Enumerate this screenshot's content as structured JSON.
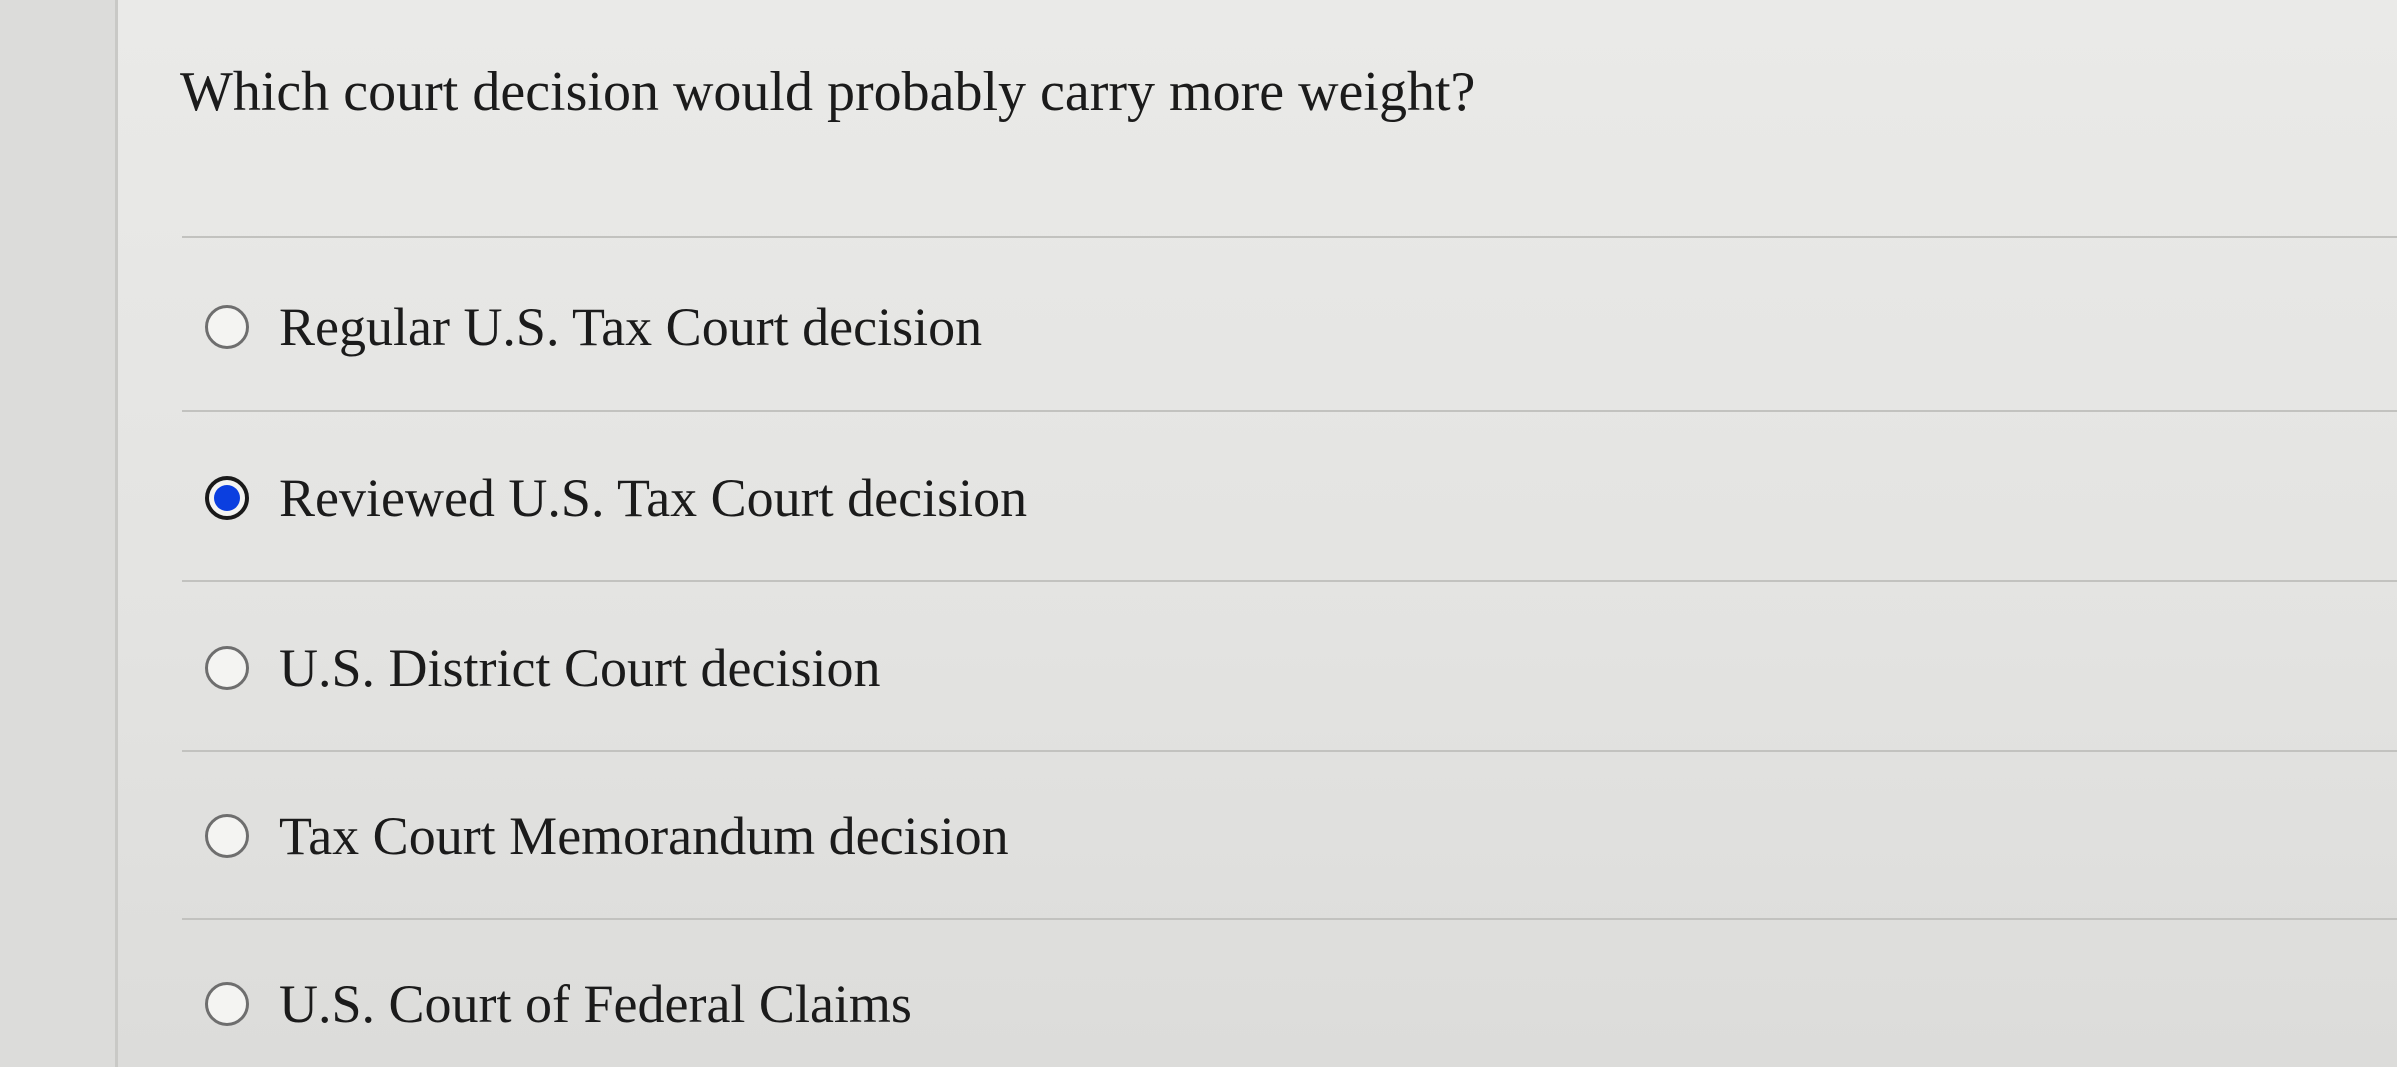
{
  "question": {
    "text": "Which court decision would probably carry more weight?"
  },
  "options": [
    {
      "label": "Regular U.S. Tax Court decision",
      "selected": false
    },
    {
      "label": "Reviewed U.S. Tax Court decision",
      "selected": true
    },
    {
      "label": "U.S. District Court decision",
      "selected": false
    },
    {
      "label": "Tax Court Memorandum decision",
      "selected": false
    },
    {
      "label": "U.S. Court of Federal Claims",
      "selected": false
    }
  ],
  "colors": {
    "selected_radio": "#0b3fe0",
    "background": "#e3e3e1"
  }
}
